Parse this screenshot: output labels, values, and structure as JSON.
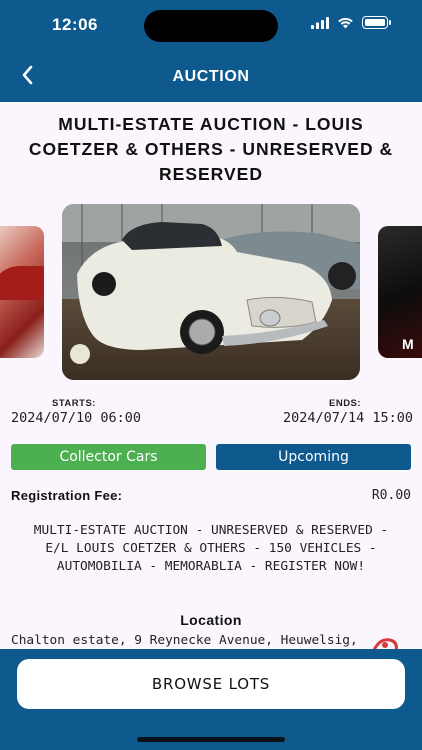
{
  "status_bar": {
    "time": "12:06"
  },
  "nav": {
    "title": "AUCTION"
  },
  "auction": {
    "title": "MULTI-ESTATE AUCTION - LOUIS COETZER & OTHERS - UNRESERVED & RESERVED",
    "starts_label": "STARTS:",
    "starts_value": "2024/07/10 06:00",
    "ends_label": "ENDS:",
    "ends_value": "2024/07/14 15:00",
    "category": "Collector Cars",
    "status": "Upcoming",
    "registration_label": "Registration Fee:",
    "registration_value": "R0.00",
    "description": "MULTI-ESTATE AUCTION - UNRESERVED & RESERVED - E/L LOUIS COETZER & OTHERS - 150 VEHICLES - AUTOMOBILIA - MEMORABLIA - REGISTER NOW!",
    "location_heading": "Location",
    "location_text": "Chalton estate, 9 Reynecke Avenue, Heuwelsig,"
  },
  "carousel": {
    "right_mark": "M"
  },
  "footer": {
    "browse_label": "BROWSE LOTS"
  },
  "colors": {
    "primary": "#0e5a8f",
    "green": "#4caf50",
    "background": "#fbf6fd"
  }
}
